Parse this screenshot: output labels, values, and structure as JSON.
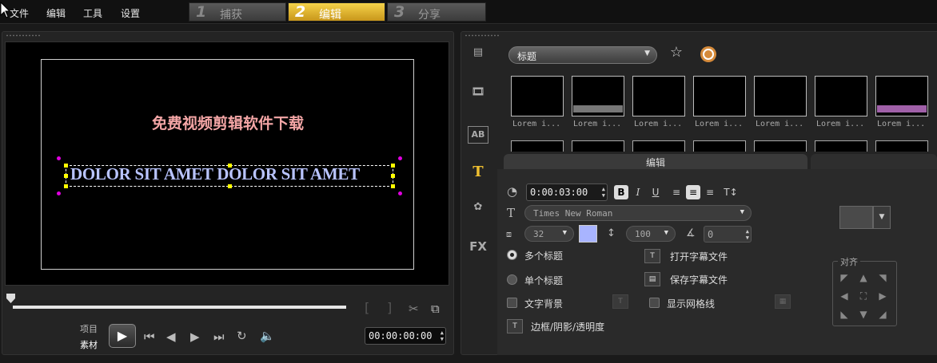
{
  "menu": {
    "file": "文件",
    "edit": "编辑",
    "tools": "工具",
    "settings": "设置"
  },
  "steps": [
    {
      "num": "1",
      "label": "捕获"
    },
    {
      "num": "2",
      "label": "编辑"
    },
    {
      "num": "3",
      "label": "分享"
    }
  ],
  "preview": {
    "title_cn": "免费视频剪辑软件下载",
    "title_en": "DOLOR SIT AMET DOLOR SIT AMET"
  },
  "transport": {
    "mode_project": "项目",
    "mode_clip": "素材",
    "timecode": "00:00:00:00"
  },
  "library": {
    "category": "标题",
    "thumb_label": "Lorem i...",
    "thumb_count": 7
  },
  "edit": {
    "tab_label": "编辑",
    "duration": "0:00:03:00",
    "font": "Times New Roman",
    "font_size": "32",
    "line_spacing": "100",
    "rotation": "0",
    "multi_title": "多个标题",
    "single_title": "单个标题",
    "open_subtitle": "打开字幕文件",
    "save_subtitle": "保存字幕文件",
    "text_background": "文字背景",
    "show_grid": "显示网格线",
    "border_shadow": "边框/阴影/透明度",
    "align_label": "对齐",
    "text_color": "#a8b4ff"
  },
  "colors": {
    "active_tab": "#e0b12b",
    "title_cn_color": "#f4a6a6",
    "title_en_color": "#b9c4ff"
  }
}
